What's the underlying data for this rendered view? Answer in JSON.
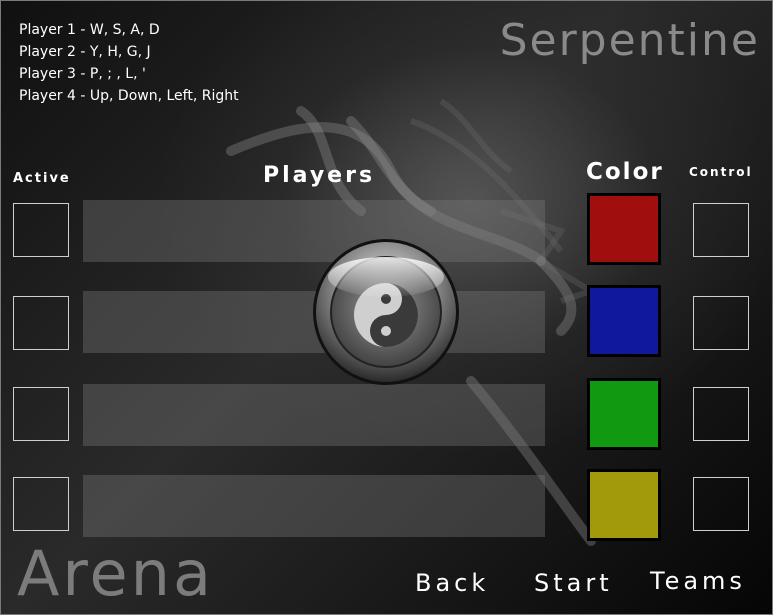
{
  "title": "Serpentine",
  "subtitle": "Arena",
  "controls_help": [
    "Player 1 - W, S, A, D",
    "Player 2 - Y, H, G, J",
    "Player 3 - P, ; , L, '",
    "Player 4 - Up, Down, Left, Right"
  ],
  "headers": {
    "active": "Active",
    "players": "Players",
    "color": "Color",
    "control": "Control"
  },
  "players": [
    {
      "name": "",
      "active": false,
      "color": "#a00e0e",
      "control": ""
    },
    {
      "name": "",
      "active": false,
      "color": "#10189e",
      "control": ""
    },
    {
      "name": "",
      "active": false,
      "color": "#119a11",
      "control": ""
    },
    {
      "name": "",
      "active": false,
      "color": "#a39a0b",
      "control": ""
    }
  ],
  "buttons": {
    "back": "Back",
    "start": "Start",
    "teams": "Teams"
  },
  "center_icon": "yin-yang-icon",
  "accent_colors": {
    "background": "#1a1a1a",
    "panel": "#6a6a6a",
    "text": "#ffffff",
    "logo": "#8a8a8a"
  }
}
